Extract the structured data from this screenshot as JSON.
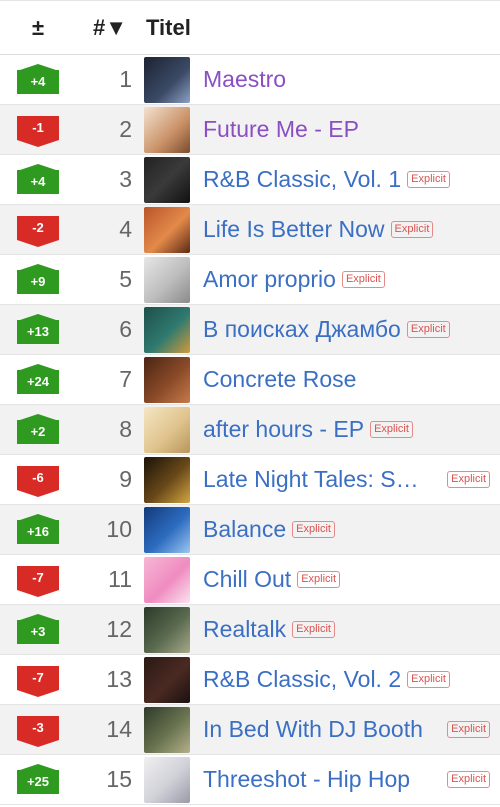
{
  "header": {
    "change": "±",
    "rank": "#▼",
    "title": "Titel"
  },
  "explicit_label": "Explicit",
  "colors": {
    "up": "#2e9a1f",
    "down": "#d92b26",
    "link": "#3a6fc4",
    "visited": "#8a4fc2"
  },
  "rows": [
    {
      "change": "+4",
      "dir": "up",
      "rank": "1",
      "title": "Maestro",
      "explicit": false,
      "visited": true,
      "cover": "linear-gradient(135deg,#1c2333,#3b4a66 60%,#8ea2c4)"
    },
    {
      "change": "-1",
      "dir": "down",
      "rank": "2",
      "title": "Future Me - EP",
      "explicit": false,
      "visited": true,
      "cover": "linear-gradient(135deg,#f3e2cf,#c99066 60%,#7a4b2e)"
    },
    {
      "change": "+4",
      "dir": "up",
      "rank": "3",
      "title": "R&B Classic, Vol. 1",
      "explicit": true,
      "visited": false,
      "cover": "linear-gradient(135deg,#222,#3a3a3a 50%,#111)"
    },
    {
      "change": "-2",
      "dir": "down",
      "rank": "4",
      "title": "Life Is Better Now",
      "explicit": true,
      "visited": false,
      "cover": "linear-gradient(135deg,#b9542a,#e38a4a 55%,#5a2a14)"
    },
    {
      "change": "+9",
      "dir": "up",
      "rank": "5",
      "title": "Amor proprio",
      "explicit": true,
      "visited": false,
      "cover": "linear-gradient(135deg,#e6e6e6,#bdbdbd 55%,#8a8a8a)"
    },
    {
      "change": "+13",
      "dir": "up",
      "rank": "6",
      "title": "В поисках Джамбо",
      "explicit": true,
      "visited": false,
      "cover": "linear-gradient(135deg,#1e4f4a,#2f7a6f 55%,#d19a3a)"
    },
    {
      "change": "+24",
      "dir": "up",
      "rank": "7",
      "title": "Concrete Rose",
      "explicit": false,
      "visited": false,
      "cover": "linear-gradient(135deg,#4a2514,#8a4a28 55%,#c67b4a)"
    },
    {
      "change": "+2",
      "dir": "up",
      "rank": "8",
      "title": "after hours - EP",
      "explicit": true,
      "visited": false,
      "cover": "linear-gradient(135deg,#f5e6c4,#e0c48e 55%,#b8965c)"
    },
    {
      "change": "-6",
      "dir": "down",
      "rank": "9",
      "title": "Late Night Tales: Sault",
      "explicit": true,
      "visited": false,
      "trunc": true,
      "cover": "linear-gradient(135deg,#1a1208,#6a4a1a 55%,#d4a640)"
    },
    {
      "change": "+16",
      "dir": "up",
      "rank": "10",
      "title": "Balance",
      "explicit": true,
      "visited": false,
      "cover": "linear-gradient(135deg,#123a7a,#2d6cc0 55%,#9cc7f0)"
    },
    {
      "change": "-7",
      "dir": "down",
      "rank": "11",
      "title": "Chill Out",
      "explicit": true,
      "visited": false,
      "cover": "linear-gradient(135deg,#f7b6d6,#ef8cc0 55%,#fbe3ef)"
    },
    {
      "change": "+3",
      "dir": "up",
      "rank": "12",
      "title": "Realtalk",
      "explicit": true,
      "visited": false,
      "cover": "linear-gradient(135deg,#2a3a2a,#5a6a4e 55%,#a7a98a)"
    },
    {
      "change": "-7",
      "dir": "down",
      "rank": "13",
      "title": "R&B Classic, Vol. 2",
      "explicit": true,
      "visited": false,
      "cover": "linear-gradient(135deg,#2a1a14,#4a2a22 55%,#1a1010)"
    },
    {
      "change": "-3",
      "dir": "down",
      "rank": "14",
      "title": "In Bed With DJ Booth",
      "explicit": true,
      "visited": false,
      "trunc": true,
      "cover": "linear-gradient(135deg,#2e3a2a,#6a7450 55%,#b4b08a)"
    },
    {
      "change": "+25",
      "dir": "up",
      "rank": "15",
      "title": "Threeshot - Hip Hop",
      "explicit": true,
      "visited": false,
      "trunc": true,
      "cover": "linear-gradient(135deg,#f0f0f0,#d0d0d8 55%,#9a9aa8)"
    }
  ]
}
